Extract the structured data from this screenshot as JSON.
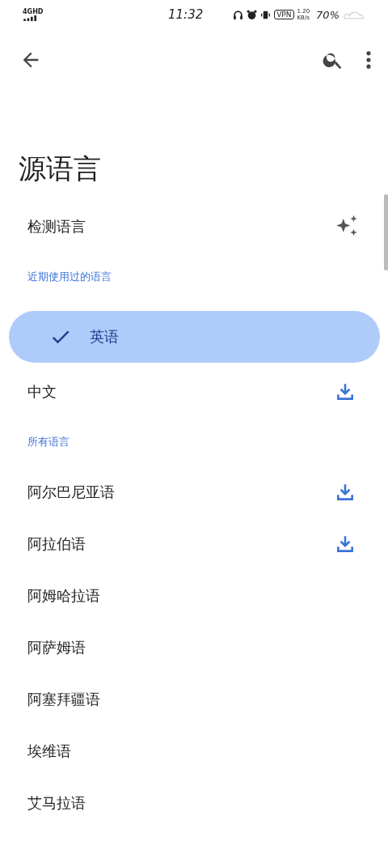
{
  "status_bar": {
    "network": "4GHD",
    "time": "11:32",
    "vpn": "VPN",
    "speed": "1.20",
    "speed_unit": "KB/s",
    "battery": "70%"
  },
  "title": "源语言",
  "detect": {
    "label": "检测语言"
  },
  "sections": [
    {
      "heading": "近期使用过的语言",
      "items": [
        {
          "label": "英语",
          "selected": true,
          "download": false
        },
        {
          "label": "中文",
          "selected": false,
          "download": true
        }
      ]
    },
    {
      "heading": "所有语言",
      "items": [
        {
          "label": "阿尔巴尼亚语",
          "selected": false,
          "download": true
        },
        {
          "label": "阿拉伯语",
          "selected": false,
          "download": true
        },
        {
          "label": "阿姆哈拉语",
          "selected": false,
          "download": false
        },
        {
          "label": "阿萨姆语",
          "selected": false,
          "download": false
        },
        {
          "label": "阿塞拜疆语",
          "selected": false,
          "download": false
        },
        {
          "label": "埃维语",
          "selected": false,
          "download": false
        },
        {
          "label": "艾马拉语",
          "selected": false,
          "download": false
        }
      ]
    }
  ]
}
